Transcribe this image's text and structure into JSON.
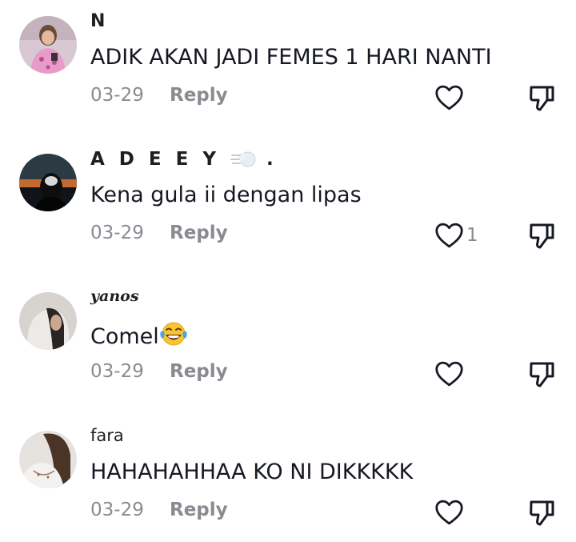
{
  "comments": [
    {
      "username": "N",
      "text": "ADIK AKAN JADI FEMES 1 HARI NANTI",
      "date": "03-29",
      "reply_label": "Reply",
      "like_count": ""
    },
    {
      "username": "A D E E Y",
      "username_suffix": ".",
      "text": "Kena gula ii dengan lipas",
      "date": "03-29",
      "reply_label": "Reply",
      "like_count": "1"
    },
    {
      "username": "yanos",
      "text": "Comel",
      "date": "03-29",
      "reply_label": "Reply",
      "like_count": ""
    },
    {
      "username": "fara",
      "text": "HAHAHAHHAA KO NI DIKKKKK",
      "date": "03-29",
      "reply_label": "Reply",
      "like_count": ""
    }
  ],
  "icons": {
    "like": "heart-outline-icon",
    "dislike": "thumbs-down-icon",
    "emoji_laugh": "face-with-tears-of-joy-icon",
    "emoji_dash": "dashing-away-icon"
  },
  "colors": {
    "text": "#161823",
    "secondary": "#8a8b91",
    "icon": "#161823"
  }
}
